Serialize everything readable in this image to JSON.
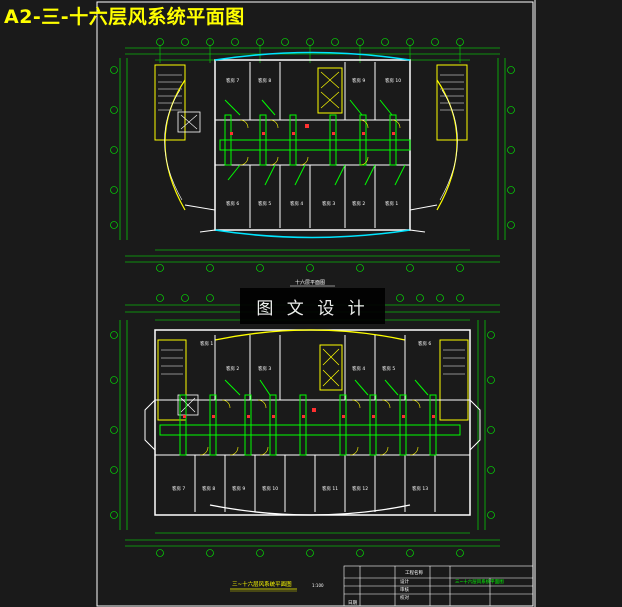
{
  "drawing": {
    "sheet_title": "A2-三-十六层风系统平面图",
    "watermark": "图 文 设 计",
    "plan_upper_caption": "十六层平面图",
    "plan_lower_caption": "三~十六层风系统平面图",
    "scale_text": "1:100",
    "title_block": {
      "project": "工程名称",
      "drawing_name": "三~十六层风系统平面图",
      "rows": [
        "设计",
        "审核",
        "校对",
        "日期"
      ]
    },
    "room_labels_upper": [
      "客房 7",
      "客房 8",
      "客房 9",
      "客房 10",
      "客房 6",
      "客房 5",
      "客房 4",
      "客房 3",
      "客房 2",
      "客房 1"
    ],
    "room_labels_lower": [
      "客房 1",
      "客房 2",
      "客房 3",
      "客房 4",
      "客房 5",
      "客房 6",
      "客房 7",
      "客房 8",
      "客房 9",
      "客房 10",
      "客房 11",
      "客房 12",
      "客房 13"
    ]
  },
  "colors": {
    "background": "#1a1a1a",
    "wall": "#ffffff",
    "duct": "#00ff00",
    "dimension": "#00ff00",
    "accent_yellow": "#ffff00",
    "accent_cyan": "#00e5ff",
    "accent_red": "#ff3030",
    "frame": "#ffffff"
  }
}
